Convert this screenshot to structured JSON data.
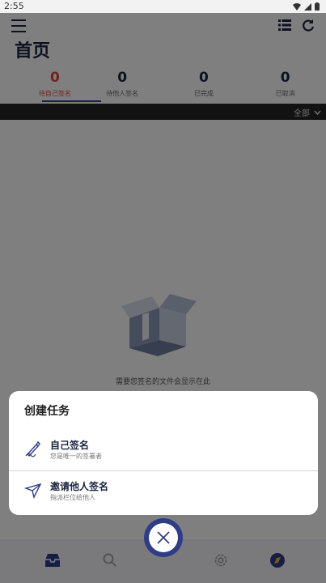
{
  "status": {
    "time": "2:55"
  },
  "header": {
    "title": "首页"
  },
  "tabs": [
    {
      "count": "0",
      "label": "待自己签名"
    },
    {
      "count": "0",
      "label": "待他人签名"
    },
    {
      "count": "0",
      "label": "已完成"
    },
    {
      "count": "0",
      "label": "已取消"
    }
  ],
  "filter": {
    "label": "全部"
  },
  "empty": {
    "message": "需要您签名的文件会显示在此"
  },
  "sheet": {
    "title": "创建任务",
    "options": [
      {
        "title": "自己签名",
        "subtitle": "您是唯一的签署者"
      },
      {
        "title": "邀请他人签名",
        "subtitle": "指派栏位给他人"
      }
    ]
  },
  "colors": {
    "accent": "#2f3c86",
    "active_tab": "#e3443a",
    "dark_text": "#1b2540"
  }
}
